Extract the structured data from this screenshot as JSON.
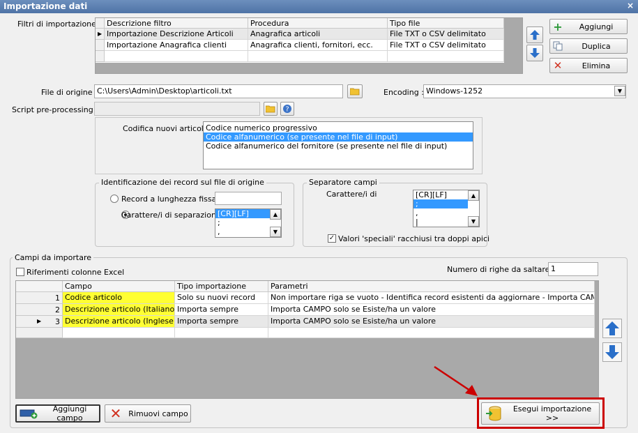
{
  "window": {
    "title": "Importazione dati",
    "close_glyph": "×"
  },
  "filters": {
    "label": "Filtri di importazione :",
    "columns": [
      "Descrizione filtro",
      "Procedura",
      "Tipo file"
    ],
    "rows": [
      [
        "Importazione Descrizione Articoli",
        "Anagrafica articoli",
        "File TXT o CSV delimitato"
      ],
      [
        "Importazione Anagrafica clienti",
        "Anagrafica clienti, fornitori, ecc.",
        "File TXT o CSV delimitato"
      ]
    ],
    "buttons": {
      "add": "Aggiungi",
      "duplicate": "Duplica",
      "delete": "Elimina"
    }
  },
  "origin": {
    "file_label": "File di origine :",
    "file_value": "C:\\Users\\Admin\\Desktop\\articoli.txt",
    "encoding_label": "Encoding :",
    "encoding_value": "Windows-1252",
    "script_label": "Script pre-processing :",
    "script_value": ""
  },
  "codifica": {
    "label": "Codifica nuovi articoli :",
    "options": [
      "Codice numerico progressivo",
      "Codice alfanumerico (se presente nel file di input)",
      "Codice alfanumerico del fornitore (se presente nel file di input)"
    ],
    "selected_index": 1
  },
  "identificazione": {
    "title": "Identificazione dei record sul file di origine",
    "fixed_label": "Record a lunghezza fissa",
    "fixed_value": "",
    "sep_label": "Carattere/i di separazione",
    "sep_items": [
      "[CR][LF]",
      ";",
      ","
    ]
  },
  "separatore": {
    "title": "Separatore campi",
    "chars_label": "Carattere/i di",
    "items": [
      "[CR][LF]",
      ";",
      ",",
      "|"
    ],
    "selected_index": 1,
    "quoted_label": "Valori 'speciali' racchiusi tra doppi apici",
    "quoted_checked": true
  },
  "campi": {
    "title": "Campi da importare",
    "excel_label": "Riferimenti colonne Excel",
    "skip_label": "Numero di righe da saltare :",
    "skip_value": "1",
    "columns": [
      "Campo",
      "Tipo importazione",
      "Parametri"
    ],
    "rows": [
      {
        "num": "1",
        "campo": "Codice articolo",
        "tipo": "Solo su nuovi record",
        "parametri": "Non importare riga se vuoto - Identifica record esistenti da aggiornare - Importa CAMPO solo ..."
      },
      {
        "num": "2",
        "campo": "Descrizione articolo (Italiano)",
        "tipo": "Importa sempre",
        "parametri": "Importa CAMPO solo se Esiste/ha un valore"
      },
      {
        "num": "3",
        "campo": "Descrizione articolo (Inglese)",
        "tipo": "Importa sempre",
        "parametri": "Importa CAMPO solo se Esiste/ha un valore"
      }
    ],
    "add_field": "Aggiungi campo",
    "remove_field": "Rimuovi campo",
    "run_import": "Esegui importazione >>"
  },
  "colors": {
    "highlight_yellow": "#ffff33",
    "selection_blue": "#3399ff",
    "annotation_red": "#cc0000",
    "arrow_blue": "#2a6fc9"
  }
}
